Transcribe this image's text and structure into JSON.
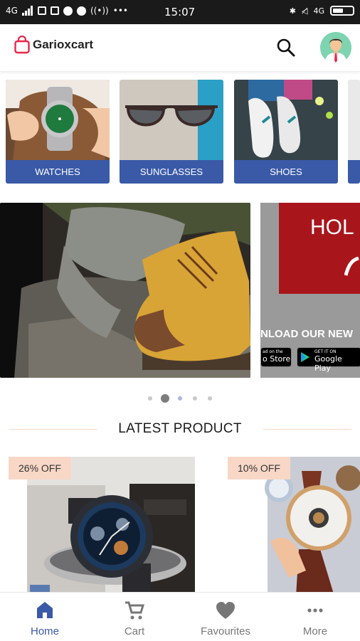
{
  "status_bar": {
    "network_left": "4G",
    "time": "15:07",
    "network_right": "4G",
    "icons": [
      "signal-icon",
      "sim-icon",
      "notification-icon",
      "check-icon",
      "chat-icon",
      "hotspot-icon",
      "more-icon",
      "bluetooth-icon",
      "mute-icon",
      "battery-icon"
    ]
  },
  "header": {
    "app_name": "Garioxcart",
    "brand_color": "#e8264a",
    "search_icon": "search-icon",
    "avatar_icon": "user-avatar-icon"
  },
  "categories": [
    {
      "label": "WATCHES"
    },
    {
      "label": "SUNGLASSES"
    },
    {
      "label": "SHOES"
    }
  ],
  "banners": {
    "promo_title": "HOL",
    "promo_text": "NLOAD OUR NEW",
    "app_store": "o Store",
    "app_store_small": "ad on the",
    "google_play": "Google Play",
    "google_play_small": "GET IT ON"
  },
  "carousel": {
    "page_count": 5,
    "active_index": 1
  },
  "latest_section": {
    "title": "LATEST PRODUCT"
  },
  "products": [
    {
      "badge": "26% OFF"
    },
    {
      "badge": "10% OFF"
    }
  ],
  "bottom_nav": [
    {
      "label": "Home",
      "icon": "home-icon",
      "active": true
    },
    {
      "label": "Cart",
      "icon": "cart-icon",
      "active": false
    },
    {
      "label": "Favourites",
      "icon": "heart-icon",
      "active": false
    },
    {
      "label": "More",
      "icon": "more-dots-icon",
      "active": false
    }
  ],
  "colors": {
    "accent": "#3a5aa8",
    "badge_bg": "#f8d7c6",
    "status_bar": "#1a1a1a"
  }
}
